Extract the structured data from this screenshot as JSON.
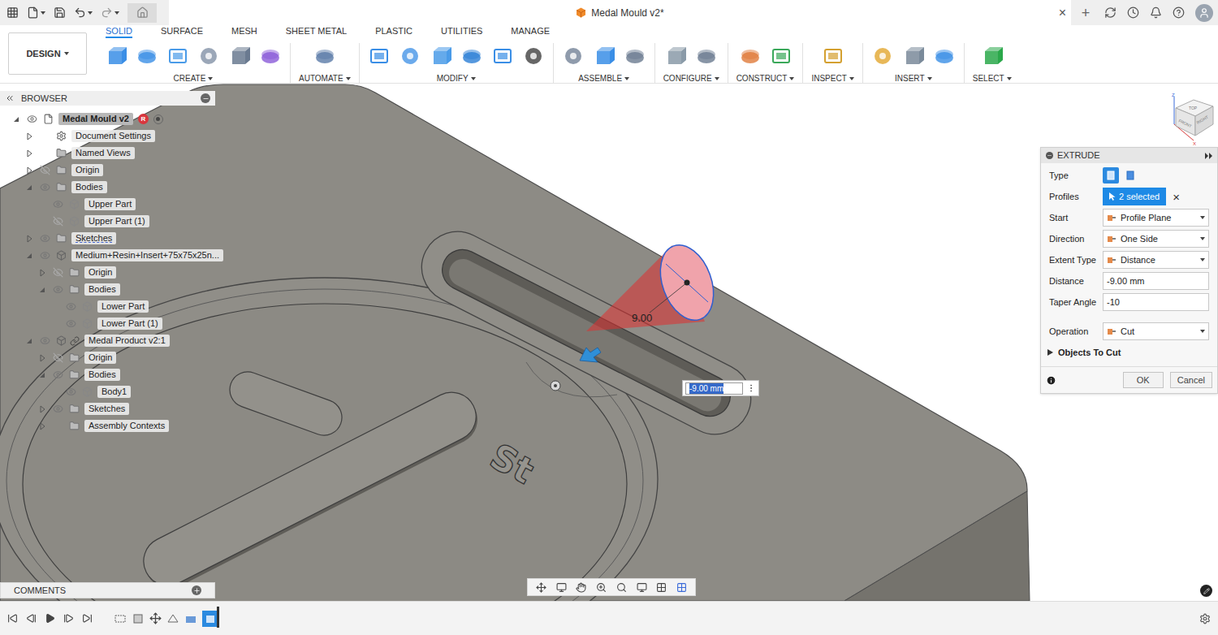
{
  "window": {
    "title": "Medal Mould v2*",
    "close": "×",
    "new_tab": "+"
  },
  "workspace": {
    "label": "DESIGN"
  },
  "tabs": [
    {
      "label": "SOLID",
      "selected": true
    },
    {
      "label": "SURFACE",
      "selected": false
    },
    {
      "label": "MESH",
      "selected": false
    },
    {
      "label": "SHEET METAL",
      "selected": false
    },
    {
      "label": "PLASTIC",
      "selected": false
    },
    {
      "label": "UTILITIES",
      "selected": false
    },
    {
      "label": "MANAGE",
      "selected": false
    }
  ],
  "toolbar_groups": [
    {
      "label": "CREATE"
    },
    {
      "label": "AUTOMATE"
    },
    {
      "label": "MODIFY"
    },
    {
      "label": "ASSEMBLE"
    },
    {
      "label": "CONFIGURE"
    },
    {
      "label": "CONSTRUCT"
    },
    {
      "label": "INSPECT"
    },
    {
      "label": "INSERT"
    },
    {
      "label": "SELECT"
    }
  ],
  "browser": {
    "title": "BROWSER",
    "badge": "R",
    "items": [
      {
        "label": "Medal Mould v2",
        "depth": 0,
        "kind": "document",
        "expanded": true,
        "visible": true,
        "flagged": false
      },
      {
        "label": "Document Settings",
        "depth": 1,
        "kind": "settings",
        "expanded": false,
        "flagged": false
      },
      {
        "label": "Named Views",
        "depth": 1,
        "kind": "folder",
        "expanded": false,
        "flagged": false
      },
      {
        "label": "Origin",
        "depth": 1,
        "kind": "folder",
        "expanded": false,
        "visible": false,
        "flagged": false
      },
      {
        "label": "Bodies",
        "depth": 1,
        "kind": "folder",
        "expanded": true,
        "visible": true,
        "flagged": false
      },
      {
        "label": "Upper Part",
        "depth": 2,
        "kind": "body",
        "visible": true,
        "flagged": false
      },
      {
        "label": "Upper Part (1)",
        "depth": 2,
        "kind": "body",
        "visible": false,
        "flagged": false
      },
      {
        "label": "Sketches",
        "depth": 1,
        "kind": "folder",
        "expanded": false,
        "visible": true,
        "flagged": true
      },
      {
        "label": "Medium+Resin+Insert+75x75x25n...",
        "depth": 1,
        "kind": "component",
        "expanded": true,
        "visible": true,
        "flagged": false
      },
      {
        "label": "Origin",
        "depth": 2,
        "kind": "folder",
        "expanded": false,
        "visible": false,
        "flagged": false
      },
      {
        "label": "Bodies",
        "depth": 2,
        "kind": "folder",
        "expanded": true,
        "visible": true,
        "flagged": false
      },
      {
        "label": "Lower Part",
        "depth": 3,
        "kind": "body",
        "visible": true,
        "flagged": false
      },
      {
        "label": "Lower Part (1)",
        "depth": 3,
        "kind": "body",
        "visible": true,
        "flagged": false
      },
      {
        "label": "Medal Product v2:1",
        "depth": 1,
        "kind": "linked-component",
        "expanded": true,
        "visible": true,
        "flagged": false
      },
      {
        "label": "Origin",
        "depth": 2,
        "kind": "folder",
        "expanded": false,
        "visible": false,
        "flagged": false
      },
      {
        "label": "Bodies",
        "depth": 2,
        "kind": "folder",
        "expanded": true,
        "visible": true,
        "flagged": false
      },
      {
        "label": "Body1",
        "depth": 3,
        "kind": "body",
        "visible": true,
        "flagged": false
      },
      {
        "label": "Sketches",
        "depth": 2,
        "kind": "folder",
        "expanded": false,
        "visible": true,
        "flagged": false
      },
      {
        "label": "Assembly Contexts",
        "depth": 2,
        "kind": "folder",
        "expanded": false,
        "flagged": false
      }
    ]
  },
  "comments": {
    "title": "COMMENTS"
  },
  "extrude": {
    "title": "EXTRUDE",
    "rows": [
      {
        "label": "Type",
        "kind": "type",
        "options": [
          {
            "selected": true
          },
          {
            "selected": false
          }
        ]
      },
      {
        "label": "Profiles",
        "kind": "selection",
        "value": "2 selected",
        "clear": "×"
      },
      {
        "label": "Start",
        "kind": "dropdown",
        "value": "Profile Plane"
      },
      {
        "label": "Direction",
        "kind": "dropdown",
        "value": "One Side"
      },
      {
        "label": "Extent Type",
        "kind": "dropdown",
        "value": "Distance"
      },
      {
        "label": "Distance",
        "kind": "input",
        "value": "-9.00 mm"
      },
      {
        "label": "Taper Angle",
        "kind": "input",
        "value": "-10"
      },
      {
        "label": "Operation",
        "kind": "dropdown",
        "value": "Cut"
      }
    ],
    "section": {
      "label": "Objects To Cut",
      "expanded": false
    },
    "buttons": [
      {
        "label": "OK"
      },
      {
        "label": "Cancel"
      }
    ]
  },
  "model": {
    "engraving": "St",
    "dimension": "9.00",
    "input": "-9.00 mm"
  },
  "view_cube": {
    "faces": [
      "TOP",
      "FRONT",
      "RIGHT"
    ],
    "axes": [
      "Z",
      "X"
    ]
  }
}
